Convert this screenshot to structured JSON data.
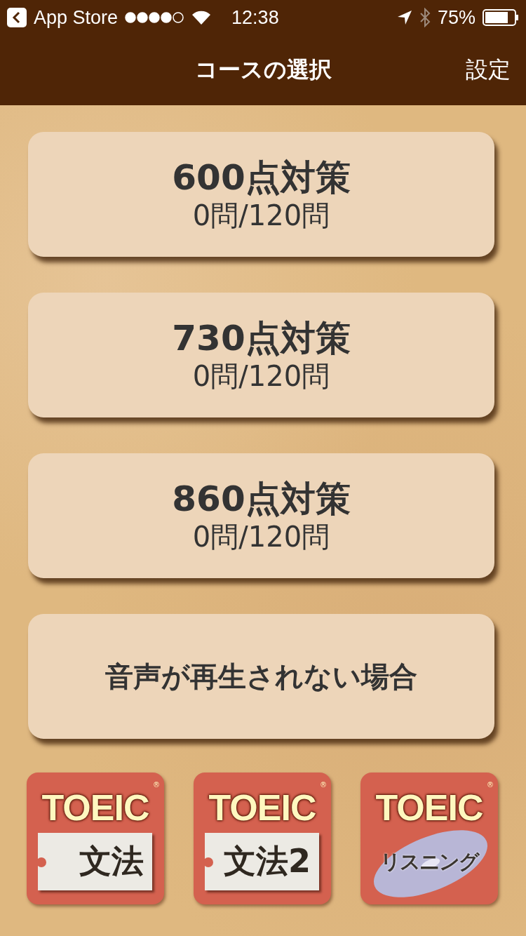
{
  "status_bar": {
    "back_label": "App Store",
    "time": "12:38",
    "battery": "75%"
  },
  "nav": {
    "title": "コースの選択",
    "right_button": "設定"
  },
  "courses": [
    {
      "title": "600点対策",
      "progress": "0問/120問"
    },
    {
      "title": "730点対策",
      "progress": "0問/120問"
    },
    {
      "title": "860点対策",
      "progress": "0問/120問"
    },
    {
      "title": "音声が再生されない場合"
    }
  ],
  "apps": [
    {
      "kind": "tag",
      "brand": "TOEIC",
      "mark": "®",
      "label": "文法"
    },
    {
      "kind": "tag",
      "brand": "TOEIC",
      "mark": "®",
      "label": "文法2"
    },
    {
      "kind": "disc",
      "brand": "TOEIC",
      "mark": "®",
      "label": "リスニング"
    }
  ]
}
